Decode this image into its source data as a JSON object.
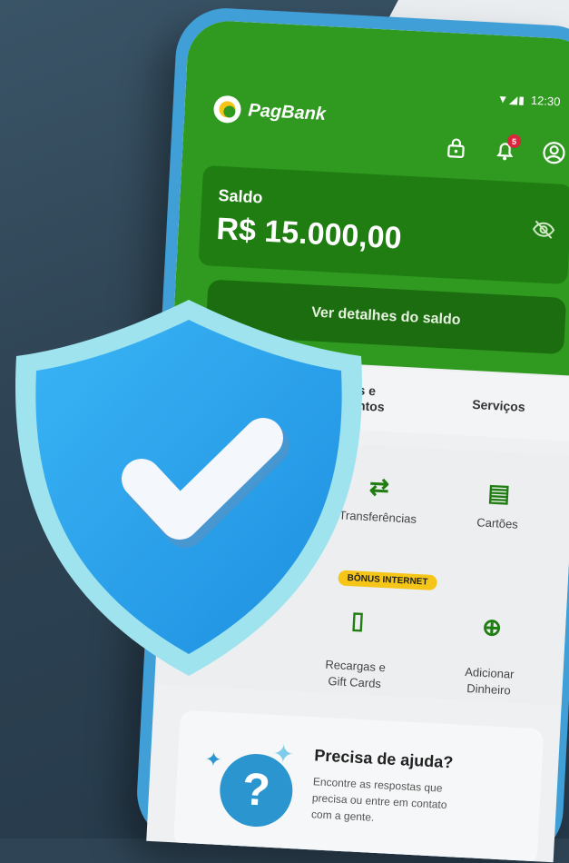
{
  "header": {
    "brand": "PagBank",
    "status_time": "12:30",
    "notification_count": "5"
  },
  "balance": {
    "label": "Saldo",
    "value": "R$ 15.000,00",
    "details_button": "Ver detalhes do saldo"
  },
  "tabs": [
    {
      "label": "Produtos e\nInvestimentos"
    },
    {
      "label": "Serviços"
    }
  ],
  "services": [
    {
      "label": "Transferências",
      "icon": "transfer-icon"
    },
    {
      "label": "Cartões",
      "icon": "card-icon"
    },
    {
      "label": "Recargas e\nGift Cards",
      "icon": "phone-recharge-icon"
    },
    {
      "label": "Adicionar\nDinheiro",
      "icon": "add-money-icon"
    }
  ],
  "promo_badge": "BÔNUS INTERNET",
  "help": {
    "title": "Precisa de ajuda?",
    "text": "Encontre as respostas que precisa ou entre em contato com a gente."
  },
  "colors": {
    "brand_green": "#2f9a1f",
    "shield_blue": "#2b9fe8",
    "phone_frame": "#3f9fd6"
  }
}
